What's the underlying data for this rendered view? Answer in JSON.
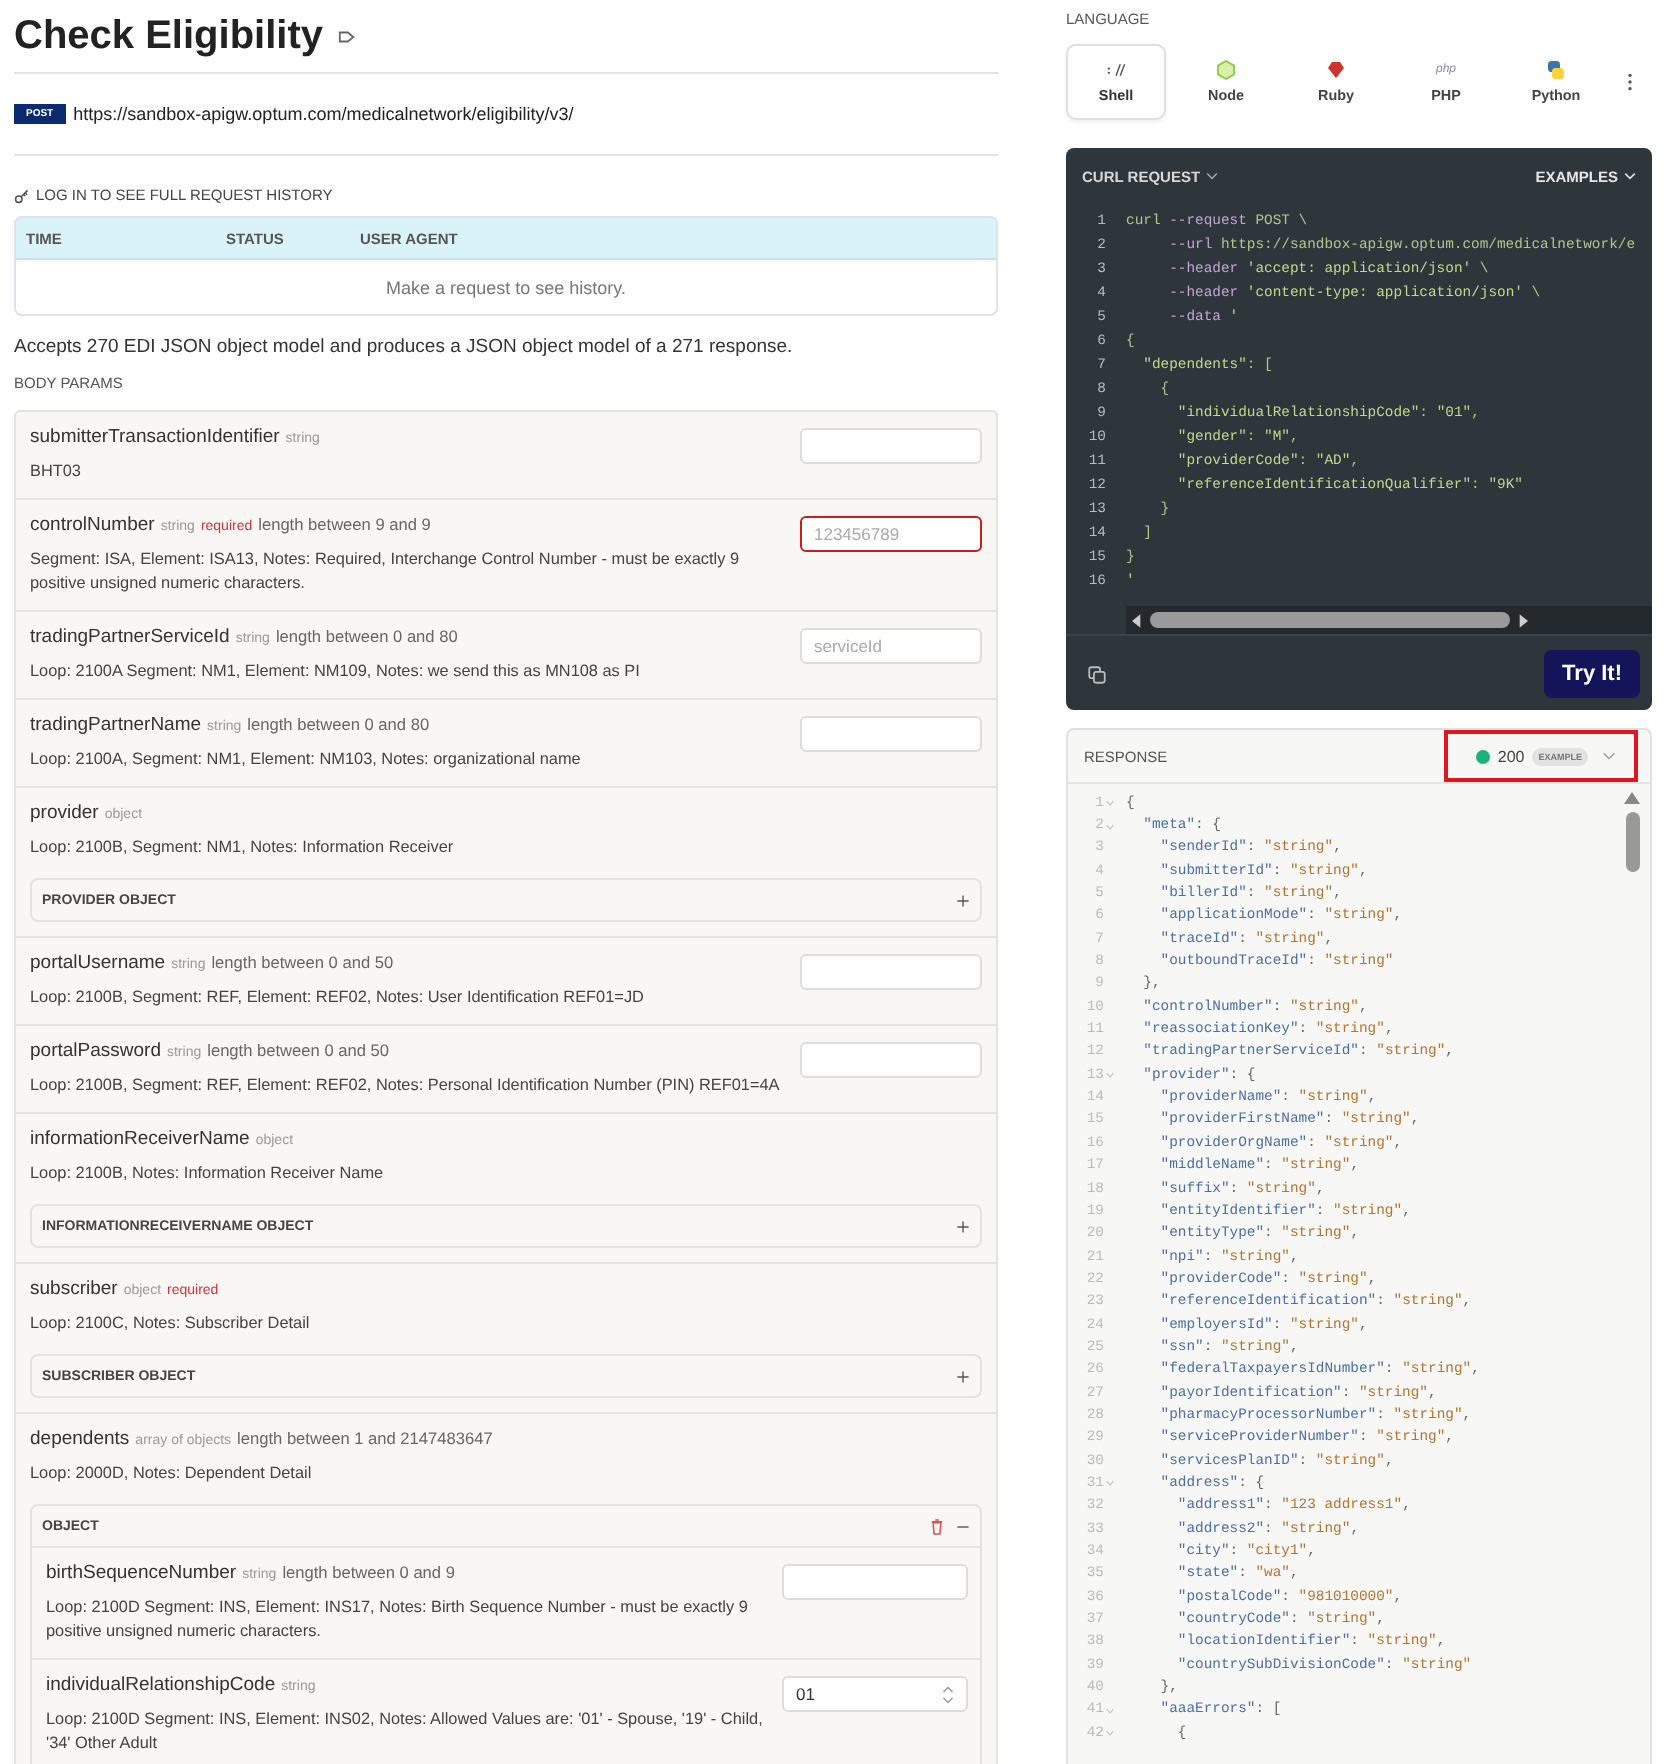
{
  "title": "Check Eligibility",
  "endpoint": {
    "method": "POST",
    "url": "https://sandbox-apigw.optum.com/medicalnetwork/eligibility/v3/"
  },
  "history": {
    "login_label": "LOG IN TO SEE FULL REQUEST HISTORY",
    "columns": [
      "TIME",
      "STATUS",
      "USER AGENT"
    ],
    "empty_text": "Make a request to see history."
  },
  "description": "Accepts 270 EDI JSON object model and produces a JSON object model of a 271 response.",
  "body_params_label": "BODY PARAMS",
  "params": [
    {
      "name": "submitterTransactionIdentifier",
      "type": "string",
      "description": "BHT03",
      "input": {
        "kind": "text"
      }
    },
    {
      "name": "controlNumber",
      "type": "string",
      "required_label": "required",
      "constraint": "length between 9 and 9",
      "description": "Segment: ISA, Element: ISA13, Notes: Required, Interchange Control Number - must be exactly 9 positive unsigned numeric characters.",
      "input": {
        "kind": "text",
        "placeholder": "123456789",
        "error": true
      }
    },
    {
      "name": "tradingPartnerServiceId",
      "type": "string",
      "constraint": "length between 0 and 80",
      "description": "Loop: 2100A Segment: NM1, Element: NM109, Notes: we send this as MN108 as PI",
      "input": {
        "kind": "text",
        "placeholder": "serviceId"
      }
    },
    {
      "name": "tradingPartnerName",
      "type": "string",
      "constraint": "length between 0 and 80",
      "description": "Loop: 2100A, Segment: NM1, Element: NM103, Notes: organizational name",
      "input": {
        "kind": "text"
      }
    },
    {
      "name": "provider",
      "type": "object",
      "description": "Loop: 2100B, Segment: NM1, Notes: Information Receiver",
      "sub": {
        "label": "PROVIDER OBJECT",
        "expanded": false
      }
    },
    {
      "name": "portalUsername",
      "type": "string",
      "constraint": "length between 0 and 50",
      "description": "Loop: 2100B, Segment: REF, Element: REF02, Notes: User Identification REF01=JD",
      "input": {
        "kind": "text"
      }
    },
    {
      "name": "portalPassword",
      "type": "string",
      "constraint": "length between 0 and 50",
      "description": "Loop: 2100B, Segment: REF, Element: REF02, Notes: Personal Identification Number (PIN) REF01=4A",
      "input": {
        "kind": "text"
      }
    },
    {
      "name": "informationReceiverName",
      "type": "object",
      "description": "Loop: 2100B, Notes: Information Receiver Name",
      "sub": {
        "label": "INFORMATIONRECEIVERNAME OBJECT",
        "expanded": false
      }
    },
    {
      "name": "subscriber",
      "type": "object",
      "required_label": "required",
      "description": "Loop: 2100C, Notes: Subscriber Detail",
      "sub": {
        "label": "SUBSCRIBER OBJECT",
        "expanded": false
      }
    },
    {
      "name": "dependents",
      "type": "array of objects",
      "constraint": "length between 1 and 2147483647",
      "description": "Loop: 2000D, Notes: Dependent Detail",
      "sub": {
        "label": "OBJECT",
        "expanded": true,
        "children": [
          {
            "name": "birthSequenceNumber",
            "type": "string",
            "constraint": "length between 0 and 9",
            "description": "Loop: 2100D Segment: INS, Element: INS17, Notes: Birth Sequence Number - must be exactly 9 positive unsigned numeric characters.",
            "input": {
              "kind": "text"
            }
          },
          {
            "name": "individualRelationshipCode",
            "type": "string",
            "description": "Loop: 2100D Segment: INS, Element: INS02, Notes: Allowed Values are: '01' - Spouse, '19' - Child, '34' Other Adult",
            "input": {
              "kind": "select",
              "value": "01"
            }
          }
        ]
      }
    }
  ],
  "language": {
    "label": "LANGUAGE",
    "items": [
      {
        "name": "Shell",
        "kind": "shell",
        "selected": true
      },
      {
        "name": "Node",
        "kind": "node",
        "selected": false
      },
      {
        "name": "Ruby",
        "kind": "ruby",
        "selected": false
      },
      {
        "name": "PHP",
        "kind": "php",
        "logo_text": "php",
        "selected": false
      },
      {
        "name": "Python",
        "kind": "python",
        "selected": false
      }
    ]
  },
  "request": {
    "title": "CURL REQUEST",
    "examples_label": "EXAMPLES",
    "try_label": "Try It!",
    "lines": [
      {
        "n": "1",
        "text": "curl --request POST \\"
      },
      {
        "n": "2",
        "text": "     --url https://sandbox-apigw.optum.com/medicalnetwork/e"
      },
      {
        "n": "3",
        "text": "     --header 'accept: application/json' \\"
      },
      {
        "n": "4",
        "text": "     --header 'content-type: application/json' \\"
      },
      {
        "n": "5",
        "text": "     --data '"
      },
      {
        "n": "6",
        "text": "{"
      },
      {
        "n": "7",
        "text": "  \"dependents\": ["
      },
      {
        "n": "8",
        "text": "    {"
      },
      {
        "n": "9",
        "text": "      \"individualRelationshipCode\": \"01\","
      },
      {
        "n": "10",
        "text": "      \"gender\": \"M\","
      },
      {
        "n": "11",
        "text": "      \"providerCode\": \"AD\","
      },
      {
        "n": "12",
        "text": "      \"referenceIdentificationQualifier\": \"9K\""
      },
      {
        "n": "13",
        "text": "    }"
      },
      {
        "n": "14",
        "text": "  ]"
      },
      {
        "n": "15",
        "text": "}"
      },
      {
        "n": "16",
        "text": "'"
      }
    ]
  },
  "response": {
    "title": "RESPONSE",
    "status": "200",
    "badge": "EXAMPLE",
    "highlighted": true,
    "lines": [
      {
        "n": "1",
        "text": "{",
        "fold": true
      },
      {
        "n": "2",
        "text": "  \"meta\": {",
        "fold": true
      },
      {
        "n": "3",
        "text": "    \"senderId\": \"string\",",
        "fold": false
      },
      {
        "n": "4",
        "text": "    \"submitterId\": \"string\",",
        "fold": false
      },
      {
        "n": "5",
        "text": "    \"billerId\": \"string\",",
        "fold": false
      },
      {
        "n": "6",
        "text": "    \"applicationMode\": \"string\",",
        "fold": false
      },
      {
        "n": "7",
        "text": "    \"traceId\": \"string\",",
        "fold": false
      },
      {
        "n": "8",
        "text": "    \"outboundTraceId\": \"string\"",
        "fold": false
      },
      {
        "n": "9",
        "text": "  },",
        "fold": false
      },
      {
        "n": "10",
        "text": "  \"controlNumber\": \"string\",",
        "fold": false
      },
      {
        "n": "11",
        "text": "  \"reassociationKey\": \"string\",",
        "fold": false
      },
      {
        "n": "12",
        "text": "  \"tradingPartnerServiceId\": \"string\",",
        "fold": false
      },
      {
        "n": "13",
        "text": "  \"provider\": {",
        "fold": true
      },
      {
        "n": "14",
        "text": "    \"providerName\": \"string\",",
        "fold": false
      },
      {
        "n": "15",
        "text": "    \"providerFirstName\": \"string\",",
        "fold": false
      },
      {
        "n": "16",
        "text": "    \"providerOrgName\": \"string\",",
        "fold": false
      },
      {
        "n": "17",
        "text": "    \"middleName\": \"string\",",
        "fold": false
      },
      {
        "n": "18",
        "text": "    \"suffix\": \"string\",",
        "fold": false
      },
      {
        "n": "19",
        "text": "    \"entityIdentifier\": \"string\",",
        "fold": false
      },
      {
        "n": "20",
        "text": "    \"entityType\": \"string\",",
        "fold": false
      },
      {
        "n": "21",
        "text": "    \"npi\": \"string\",",
        "fold": false
      },
      {
        "n": "22",
        "text": "    \"providerCode\": \"string\",",
        "fold": false
      },
      {
        "n": "23",
        "text": "    \"referenceIdentification\": \"string\",",
        "fold": false
      },
      {
        "n": "24",
        "text": "    \"employersId\": \"string\",",
        "fold": false
      },
      {
        "n": "25",
        "text": "    \"ssn\": \"string\",",
        "fold": false
      },
      {
        "n": "26",
        "text": "    \"federalTaxpayersIdNumber\": \"string\",",
        "fold": false
      },
      {
        "n": "27",
        "text": "    \"payorIdentification\": \"string\",",
        "fold": false
      },
      {
        "n": "28",
        "text": "    \"pharmacyProcessorNumber\": \"string\",",
        "fold": false
      },
      {
        "n": "29",
        "text": "    \"serviceProviderNumber\": \"string\",",
        "fold": false
      },
      {
        "n": "30",
        "text": "    \"servicesPlanID\": \"string\",",
        "fold": false
      },
      {
        "n": "31",
        "text": "    \"address\": {",
        "fold": true
      },
      {
        "n": "32",
        "text": "      \"address1\": \"123 address1\",",
        "fold": false
      },
      {
        "n": "33",
        "text": "      \"address2\": \"string\",",
        "fold": false
      },
      {
        "n": "34",
        "text": "      \"city\": \"city1\",",
        "fold": false
      },
      {
        "n": "35",
        "text": "      \"state\": \"wa\",",
        "fold": false
      },
      {
        "n": "36",
        "text": "      \"postalCode\": \"981010000\",",
        "fold": false
      },
      {
        "n": "37",
        "text": "      \"countryCode\": \"string\",",
        "fold": false
      },
      {
        "n": "38",
        "text": "      \"locationIdentifier\": \"string\",",
        "fold": false
      },
      {
        "n": "39",
        "text": "      \"countrySubDivisionCode\": \"string\"",
        "fold": false
      },
      {
        "n": "40",
        "text": "    },",
        "fold": false
      },
      {
        "n": "41",
        "text": "    \"aaaErrors\": [",
        "fold": true
      },
      {
        "n": "42",
        "text": "      {",
        "fold": true
      }
    ]
  }
}
